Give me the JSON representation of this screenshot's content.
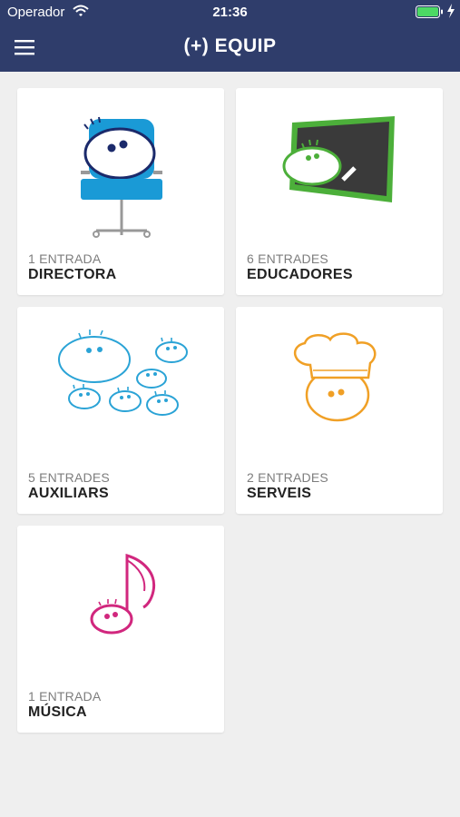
{
  "status_bar": {
    "carrier": "Operador",
    "time": "21:36",
    "wifi_icon": "wifi-icon",
    "battery_icon": "battery-icon",
    "charging_icon": "charging-bolt-icon"
  },
  "header": {
    "title": "(+) EQUIP",
    "menu_icon": "hamburger-menu-icon",
    "background": "#2f3d6b"
  },
  "cards": [
    {
      "count": "1 ENTRADA",
      "name": "DIRECTORA",
      "icon": "office-chair-character-icon",
      "color": "#1a9ad6"
    },
    {
      "count": "6 ENTRADES",
      "name": "EDUCADORES",
      "icon": "chalkboard-character-icon",
      "color": "#4caf3a"
    },
    {
      "count": "5 ENTRADES",
      "name": "AUXILIARS",
      "icon": "group-of-characters-icon",
      "color": "#2aa3d6"
    },
    {
      "count": "2 ENTRADES",
      "name": "SERVEIS",
      "icon": "chef-hat-character-icon",
      "color": "#f0a026"
    },
    {
      "count": "1 ENTRADA",
      "name": "MÚSICA",
      "icon": "music-note-character-icon",
      "color": "#d1277e"
    }
  ]
}
